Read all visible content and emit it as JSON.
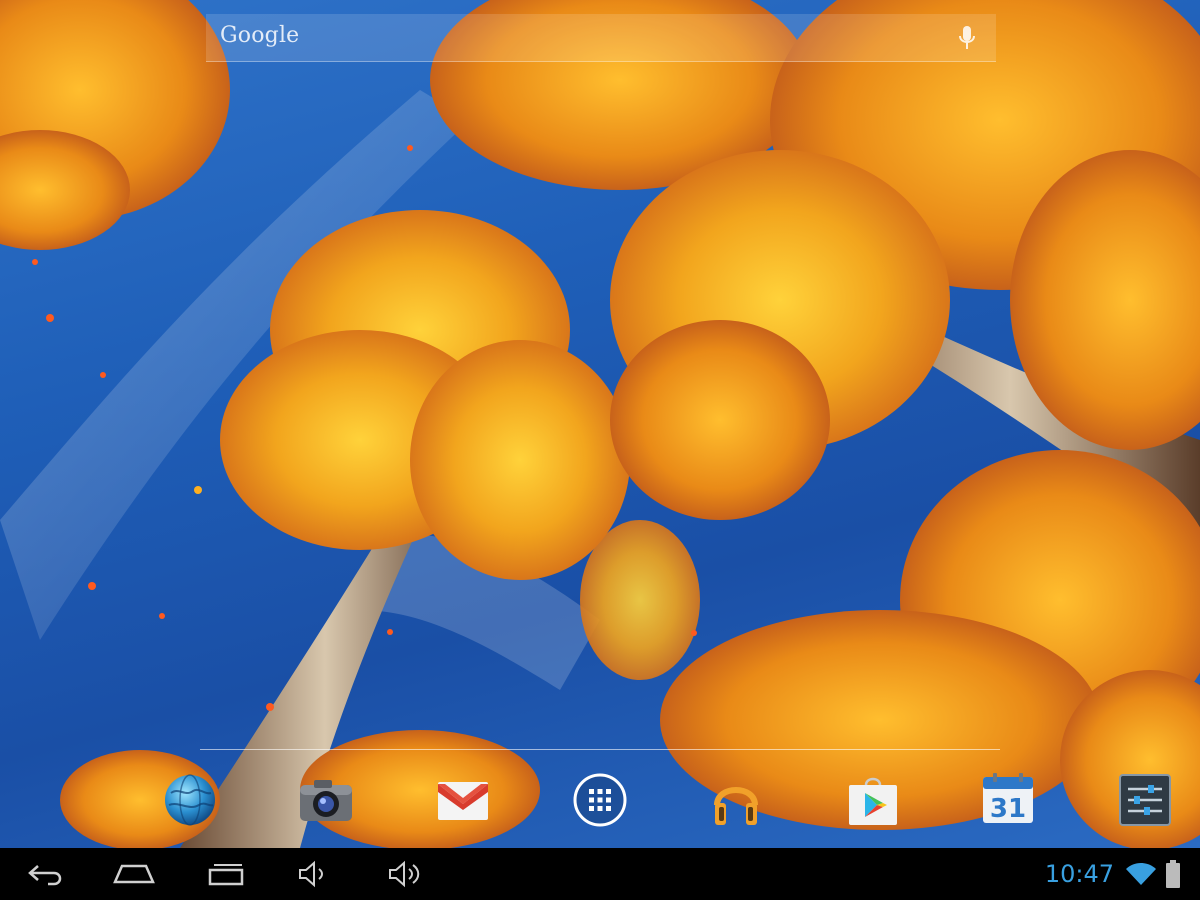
{
  "search_widget": {
    "logo": "Google"
  },
  "status_bar": {
    "time": "10:47"
  },
  "dock": {
    "apps": [
      {
        "id": "browser",
        "icon": "globe-icon"
      },
      {
        "id": "camera",
        "icon": "camera-icon"
      },
      {
        "id": "gmail",
        "icon": "gmail-icon"
      },
      {
        "id": "app-drawer",
        "icon": "apps-grid-icon"
      },
      {
        "id": "play-music",
        "icon": "headphones-icon"
      },
      {
        "id": "play-store",
        "icon": "play-store-icon"
      },
      {
        "id": "calendar",
        "icon": "calendar-icon",
        "badge": "31"
      },
      {
        "id": "settings",
        "icon": "settings-sliders-icon"
      }
    ]
  },
  "navigation": [
    "back-icon",
    "home-icon",
    "recent-apps-icon",
    "volume-down-icon",
    "volume-up-icon"
  ],
  "colors": {
    "clock": "#39a0e0",
    "sky": "#1f5fb8",
    "leaves": "#f0a020"
  }
}
